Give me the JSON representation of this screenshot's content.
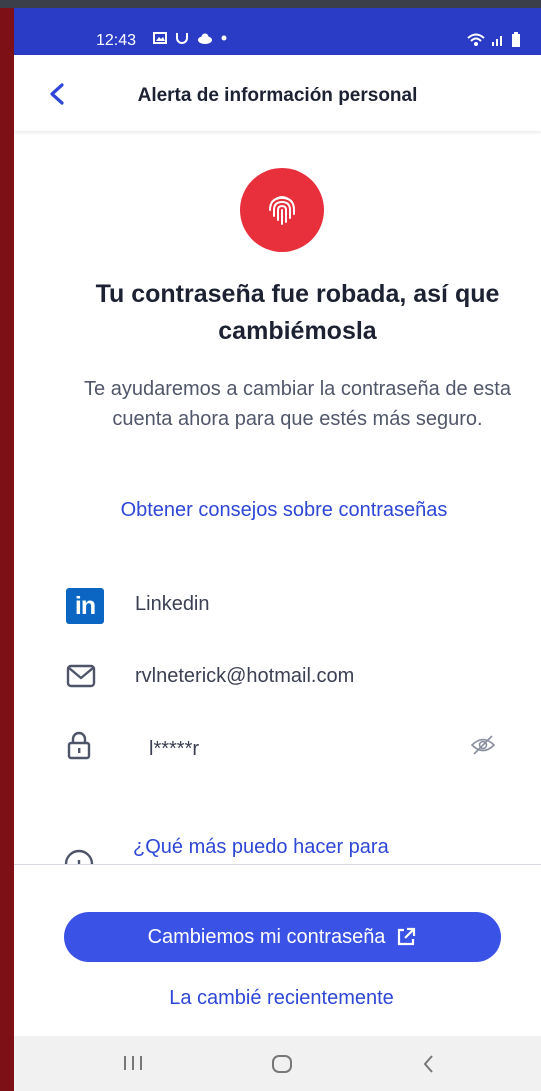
{
  "status_bar": {
    "time": "12:43"
  },
  "header": {
    "title": "Alerta de información personal"
  },
  "alert": {
    "headline": "Tu contraseña fue robada, así que cambiémosla",
    "description": "Te ayudaremos a cambiar la contraseña de esta cuenta ahora para que estés más seguro.",
    "tips_link": "Obtener consejos sobre contraseñas"
  },
  "account": {
    "service": "Linkedin",
    "email": "rvlneterick@hotmail.com",
    "password_masked": "l*****r"
  },
  "more_link": "¿Qué más puedo hacer para",
  "actions": {
    "primary": "Cambiemos mi contraseña",
    "secondary": "La cambié recientemente"
  },
  "colors": {
    "accent": "#3a52e5",
    "status_bar": "#2a3cc6",
    "alert_red": "#e8303d",
    "linkedin": "#0a66c2"
  },
  "icons": [
    "back-arrow-icon",
    "fingerprint-icon",
    "linkedin-icon",
    "mail-icon",
    "lock-icon",
    "eye-off-icon",
    "info-icon",
    "external-link-icon",
    "recents-icon",
    "home-icon",
    "back-icon"
  ]
}
